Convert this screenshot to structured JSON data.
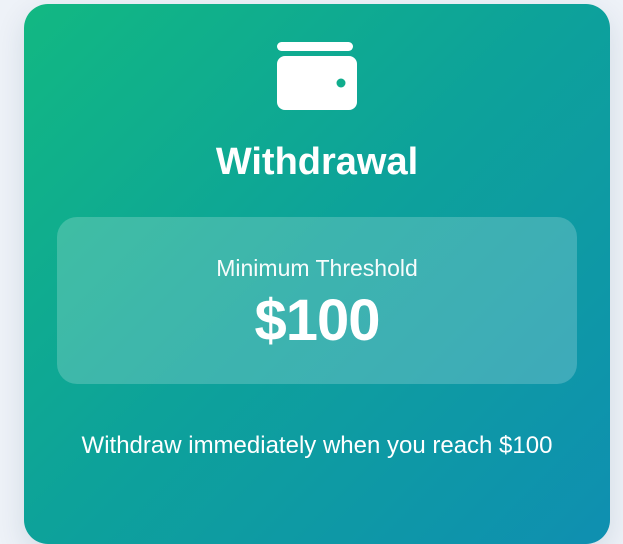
{
  "card": {
    "icon": "wallet-icon",
    "title": "Withdrawal",
    "threshold": {
      "label": "Minimum Threshold",
      "value": "$100"
    },
    "footer": "Withdraw immediately when you reach $100",
    "colors": {
      "gradient_start": "#12b882",
      "gradient_end": "#0f8fb1",
      "text": "#ffffff"
    }
  }
}
